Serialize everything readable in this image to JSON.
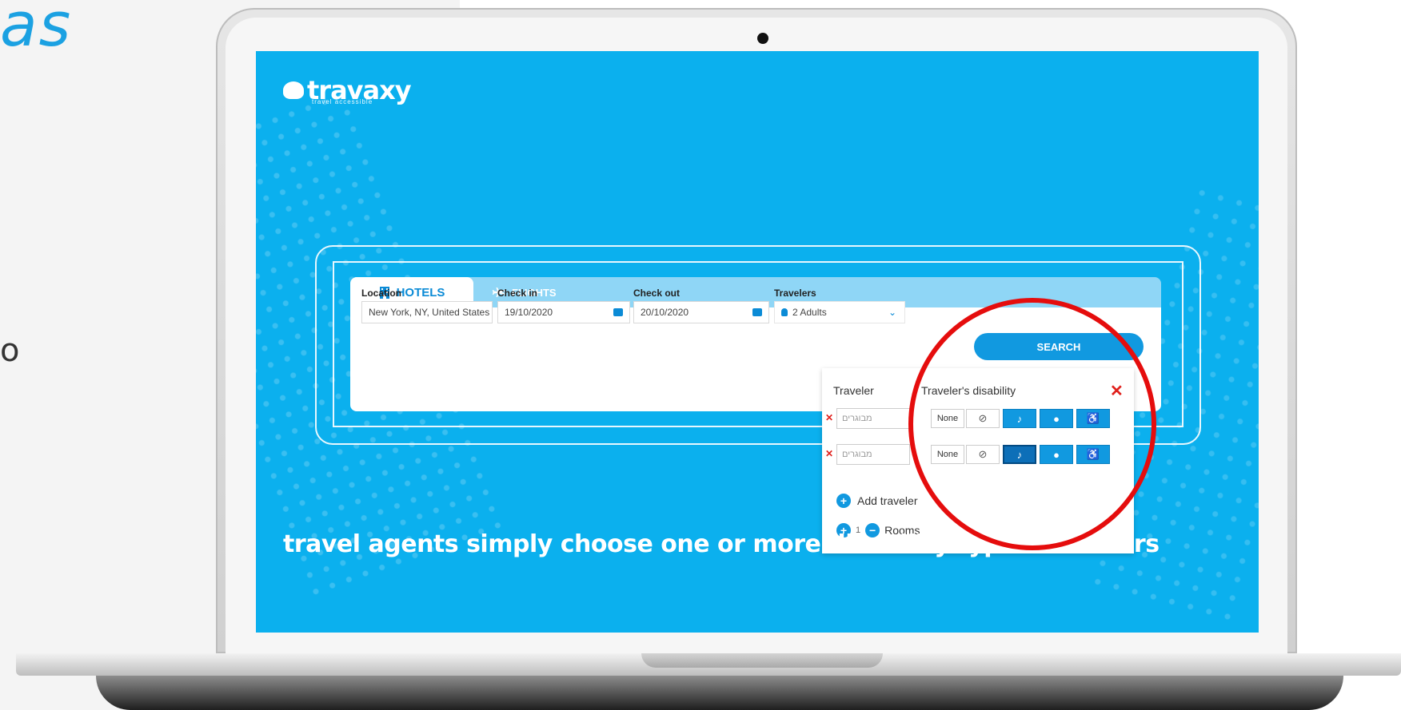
{
  "left": {
    "heading": "as",
    "fragment": "o"
  },
  "brand": {
    "name": "travaxy",
    "tagline": "travel accessible"
  },
  "tabs": {
    "hotels": "HOTELS",
    "flights": "FLIGHTS"
  },
  "fields": {
    "location_label": "Location",
    "location_value": "New York, NY, United States",
    "checkin_label": "Check in",
    "checkin_value": "19/10/2020",
    "checkout_label": "Check out",
    "checkout_value": "20/10/2020",
    "travelers_label": "Travelers",
    "travelers_value": "2 Adults"
  },
  "search_label": "SEARCH",
  "dropdown": {
    "traveler_header": "Traveler",
    "disability_header": "Traveler's disability",
    "rows": [
      {
        "type_value": "מבוגרים",
        "none_label": "None"
      },
      {
        "type_value": "מבוגרים",
        "none_label": "None"
      }
    ],
    "add_traveler": "Add traveler",
    "rooms_count": "1",
    "rooms_label": "Rooms"
  },
  "caption": "travel agents simply choose one or more disability type sub-filters",
  "colors": {
    "screen_bg": "#0bb0ee",
    "accent": "#1199e0",
    "highlight": "#e50d0d"
  }
}
